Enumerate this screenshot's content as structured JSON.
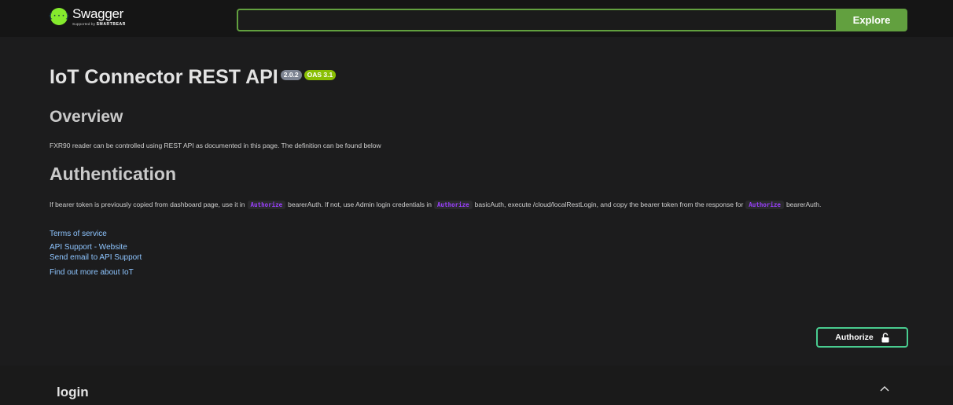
{
  "header": {
    "logo_title": "Swagger",
    "logo_sub_prefix": "Supported by",
    "logo_sub_brand": "SMARTBEAR",
    "search_value": "",
    "explore_label": "Explore"
  },
  "info": {
    "title": "IoT Connector REST API",
    "version": "2.0.2",
    "oas": "OAS 3.1",
    "overview_heading": "Overview",
    "overview_text": "FXR90 reader can be controlled using REST API as documented in this page. The definition can be found below",
    "auth_heading": "Authentication",
    "auth_text": {
      "part1": "If bearer token is previously copied from dashboard page, use it in",
      "code1": "Authorize",
      "part2": "bearerAuth. If not, use Admin login credentials in",
      "code2": "Authorize",
      "part3": "basicAuth, execute /cloud/localRestLogin, and copy the bearer token from the response for",
      "code3": "Authorize",
      "part4": "bearerAuth."
    },
    "links": {
      "terms": "Terms of service",
      "website": "API Support - Website",
      "email": "Send email to API Support",
      "external": "Find out more about IoT"
    }
  },
  "authorize_label": "Authorize",
  "section": {
    "title": "login"
  },
  "colors": {
    "accent_green": "#62a03f",
    "authorize_border": "#49cc90",
    "link": "#8ec5ff",
    "code": "#9b40ff"
  },
  "icons": {
    "logo": "swagger-logo-icon",
    "lock": "unlocked-icon",
    "chevron": "chevron-up-icon"
  }
}
